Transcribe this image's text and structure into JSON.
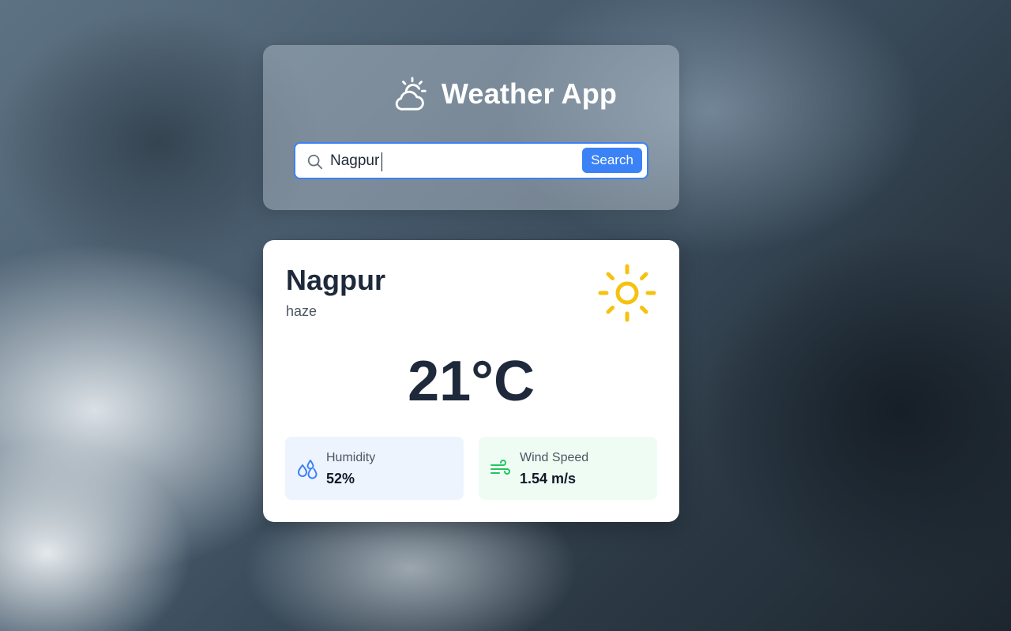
{
  "app": {
    "title": "Weather App",
    "icon": "partly-cloudy-icon"
  },
  "search": {
    "value": "Nagpur",
    "placeholder": "",
    "button_label": "Search",
    "icon": "search-icon"
  },
  "weather": {
    "city": "Nagpur",
    "description": "haze",
    "temperature": "21°C",
    "condition_icon": "sun-icon",
    "humidity": {
      "label": "Humidity",
      "value": "52%",
      "icon": "water-drops-icon"
    },
    "wind": {
      "label": "Wind Speed",
      "value": "1.54 m/s",
      "icon": "wind-icon"
    }
  },
  "colors": {
    "accent": "#3b82f6",
    "sun": "#f5c211",
    "humidity_bg": "#eef4fe",
    "wind_bg": "#effcf3",
    "wind_icon": "#22c55e",
    "text_dark": "#1e2a3b"
  }
}
